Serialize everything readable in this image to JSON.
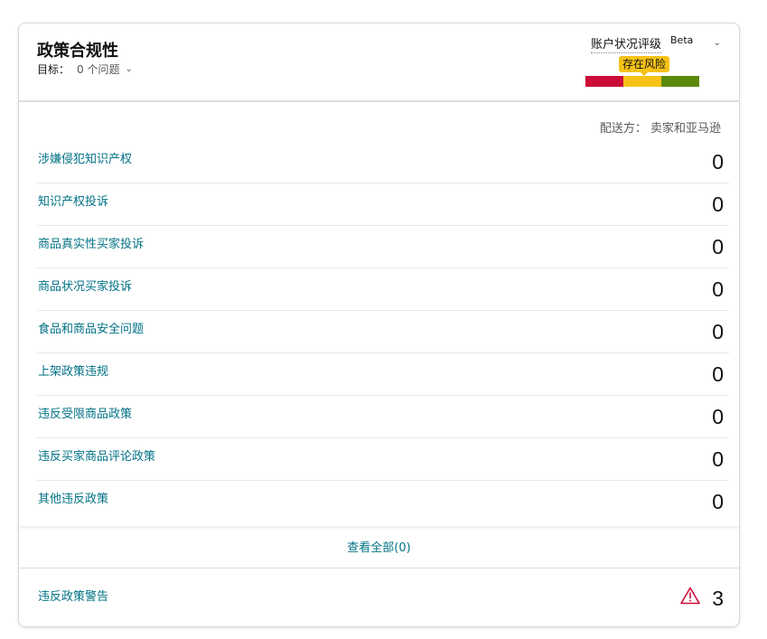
{
  "header": {
    "title": "政策合规性",
    "target_label": "目标：",
    "target_value": "0 个问题"
  },
  "health": {
    "title": "账户状况评级",
    "beta": "Beta",
    "status": "存在风险",
    "colors": [
      "#cc0c39",
      "#f6c217",
      "#5b8a0a"
    ]
  },
  "shipping": "配送方：  卖家和亚马逊",
  "rows": [
    {
      "label": "涉嫌侵犯知识产权",
      "value": "0"
    },
    {
      "label": "知识产权投诉",
      "value": "0"
    },
    {
      "label": "商品真实性买家投诉",
      "value": "0"
    },
    {
      "label": "商品状况买家投诉",
      "value": "0"
    },
    {
      "label": "食品和商品安全问题",
      "value": "0"
    },
    {
      "label": "上架政策违规",
      "value": "0"
    },
    {
      "label": "违反受限商品政策",
      "value": "0"
    },
    {
      "label": "违反买家商品评论政策",
      "value": "0"
    },
    {
      "label": "其他违反政策",
      "value": "0"
    }
  ],
  "view_all": "查看全部(0)",
  "warnings": {
    "label": "违反政策警告",
    "count": "3",
    "icon": "warning-triangle-icon"
  }
}
